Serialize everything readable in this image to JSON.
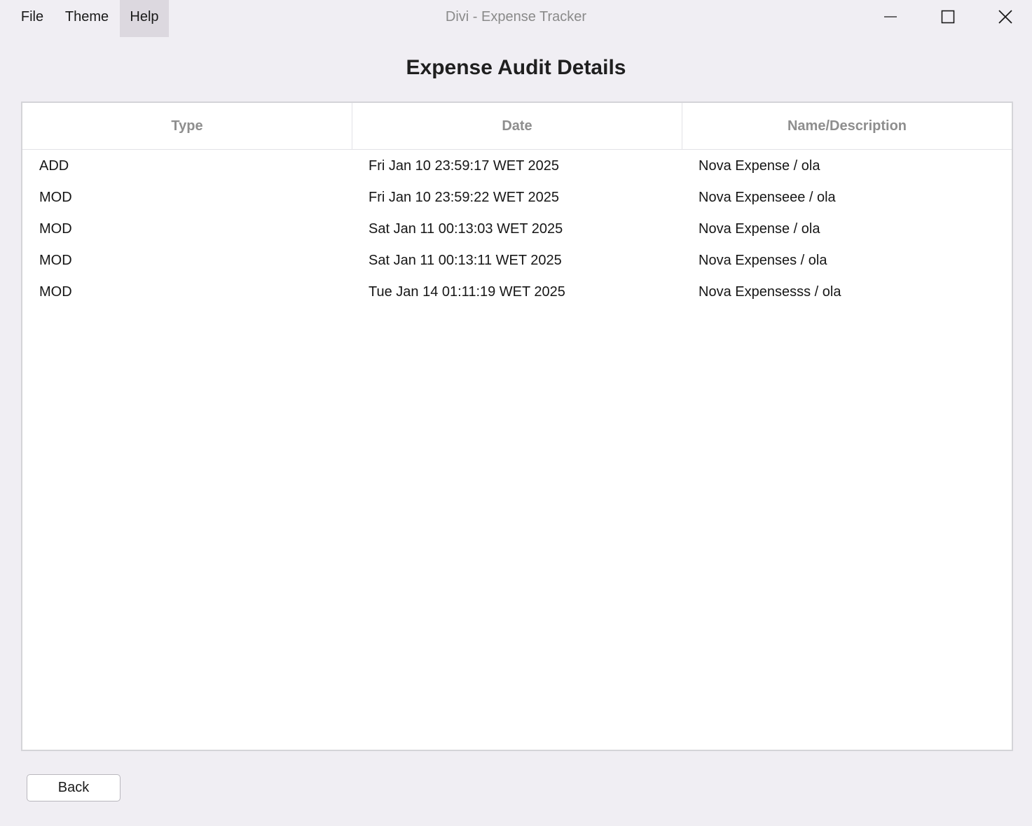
{
  "window": {
    "title": "Divi - Expense Tracker"
  },
  "menu": {
    "items": [
      {
        "label": "File"
      },
      {
        "label": "Theme"
      },
      {
        "label": "Help",
        "active": true
      }
    ]
  },
  "window_controls": {
    "minimize_icon": "minimize-icon",
    "maximize_icon": "maximize-icon",
    "close_icon": "close-icon"
  },
  "page": {
    "title": "Expense Audit Details"
  },
  "table": {
    "columns": [
      "Type",
      "Date",
      "Name/Description"
    ],
    "rows": [
      {
        "type": "ADD",
        "date": "Fri Jan 10 23:59:17 WET 2025",
        "name": "Nova Expense / ola"
      },
      {
        "type": "MOD",
        "date": "Fri Jan 10 23:59:22 WET 2025",
        "name": "Nova Expenseee / ola"
      },
      {
        "type": "MOD",
        "date": "Sat Jan 11 00:13:03 WET 2025",
        "name": "Nova Expense / ola"
      },
      {
        "type": "MOD",
        "date": "Sat Jan 11 00:13:11 WET 2025",
        "name": "Nova Expenses / ola"
      },
      {
        "type": "MOD",
        "date": "Tue Jan 14 01:11:19 WET 2025",
        "name": "Nova Expensesss / ola"
      }
    ]
  },
  "footer": {
    "back_label": "Back"
  },
  "colors": {
    "background": "#f0eef3",
    "menu_active": "#dcd8df",
    "header_text": "#8e8e8e",
    "title_text": "#8a8a8a"
  }
}
